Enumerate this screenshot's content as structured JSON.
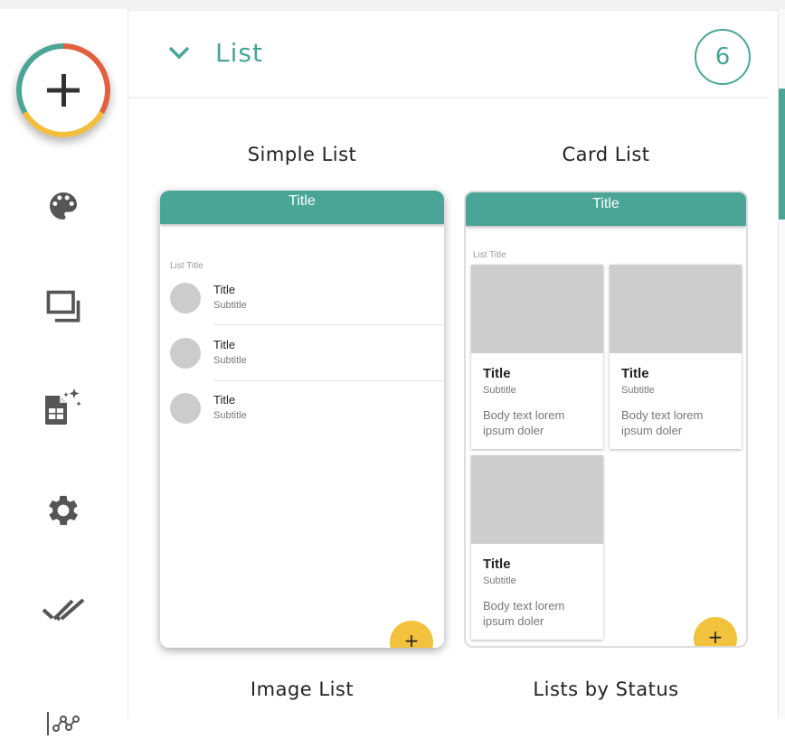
{
  "sidebar": {
    "add_icon": "plus-icon",
    "items": [
      {
        "name": "palette-icon"
      },
      {
        "name": "windows-icon"
      },
      {
        "name": "sheet-sparkle-icon"
      },
      {
        "name": "gear-icon"
      },
      {
        "name": "double-check-icon"
      },
      {
        "name": "graph-icon"
      }
    ]
  },
  "section": {
    "title": "List",
    "count": "6"
  },
  "templates": [
    {
      "label": "Simple List",
      "header": "Title",
      "list_title": "List Title",
      "rows": [
        {
          "title": "Title",
          "subtitle": "Subtitle"
        },
        {
          "title": "Title",
          "subtitle": "Subtitle"
        },
        {
          "title": "Title",
          "subtitle": "Subtitle"
        }
      ],
      "fab": "+"
    },
    {
      "label": "Card List",
      "header": "Title",
      "list_title": "List Title",
      "cards": [
        {
          "title": "Title",
          "subtitle": "Subtitle",
          "body": "Body text lorem ipsum doler"
        },
        {
          "title": "Title",
          "subtitle": "Subtitle",
          "body": "Body text lorem ipsum doler"
        },
        {
          "title": "Title",
          "subtitle": "Subtitle",
          "body": "Body text lorem ipsum doler"
        }
      ],
      "fab": "+"
    },
    {
      "label": "Image List"
    },
    {
      "label": "Lists by Status"
    }
  ],
  "colors": {
    "accent": "#4aa596",
    "fab": "#f2c23c",
    "ring_red": "#e0603f"
  }
}
